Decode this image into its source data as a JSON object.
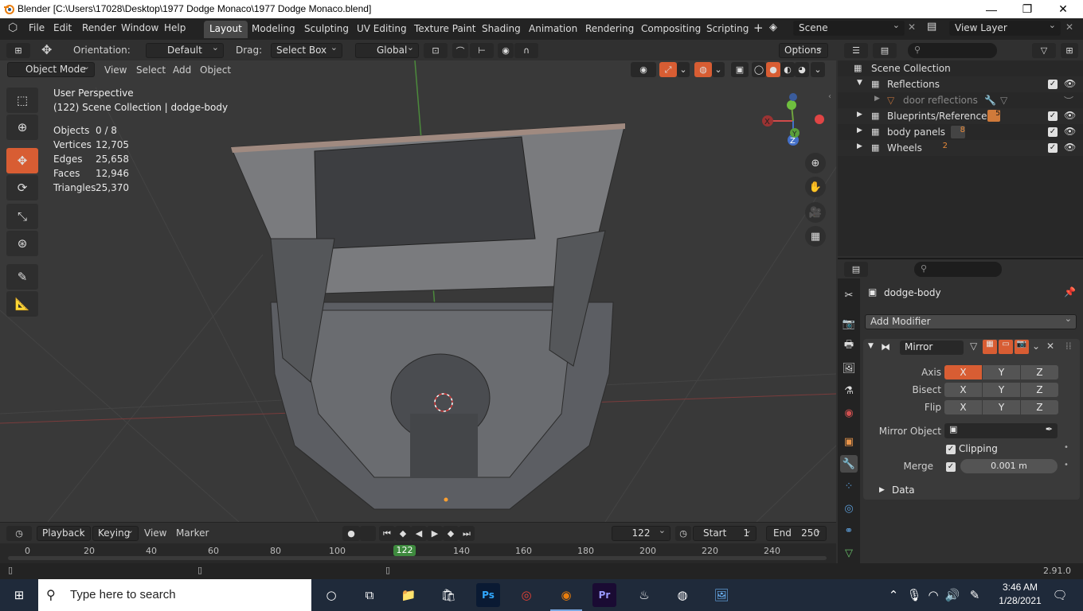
{
  "window": {
    "title": "Blender [C:\\Users\\17028\\Desktop\\1977 Dodge Monaco\\1977 Dodge Monaco.blend]",
    "minimize": "—",
    "maximize": "❐",
    "close": "✕"
  },
  "menu": [
    "File",
    "Edit",
    "Render",
    "Window",
    "Help"
  ],
  "workspaces": [
    "Layout",
    "Modeling",
    "Sculpting",
    "UV Editing",
    "Texture Paint",
    "Shading",
    "Animation",
    "Rendering",
    "Compositing",
    "Scripting"
  ],
  "active_workspace": "Layout",
  "scene": {
    "label": "Scene",
    "view_layer": "View Layer"
  },
  "tool_header": {
    "orientation_label": "Orientation:",
    "orientation_value": "Default",
    "drag_label": "Drag:",
    "drag_value": "Select Box",
    "transform_space": "Global",
    "options": "Options"
  },
  "viewport_header": {
    "mode": "Object Mode",
    "menus": [
      "View",
      "Select",
      "Add",
      "Object"
    ]
  },
  "viewport_overlay": {
    "perspective": "User Perspective",
    "collection_info": "(122) Scene Collection | dodge-body",
    "stats": [
      {
        "label": "Objects",
        "value": "0 / 8"
      },
      {
        "label": "Vertices",
        "value": "12,705"
      },
      {
        "label": "Edges",
        "value": "25,658"
      },
      {
        "label": "Faces",
        "value": "12,946"
      },
      {
        "label": "Triangles",
        "value": "25,370"
      }
    ],
    "gizmo_axes": {
      "x": "X",
      "y": "Y",
      "z": "Z"
    }
  },
  "outliner": {
    "root": "Scene Collection",
    "items": [
      {
        "name": "Reflections",
        "badge": ""
      },
      {
        "name": "door reflections",
        "badge": ""
      },
      {
        "name": "Blueprints/Reference",
        "badge": "5"
      },
      {
        "name": "body panels",
        "badge": "8"
      },
      {
        "name": "Wheels",
        "badge": "2"
      }
    ]
  },
  "properties": {
    "object_name": "dodge-body",
    "add_modifier": "Add Modifier",
    "modifier_name": "Mirror",
    "axis_label": "Axis",
    "bisect_label": "Bisect",
    "flip_label": "Flip",
    "axes": [
      "X",
      "Y",
      "Z"
    ],
    "mirror_object_label": "Mirror Object",
    "clipping_label": "Clipping",
    "merge_label": "Merge",
    "merge_value": "0.001 m",
    "data_label": "Data"
  },
  "timeline": {
    "menus": [
      "Playback",
      "Keying",
      "View",
      "Marker"
    ],
    "current_frame": "122",
    "start_label": "Start",
    "start_value": "1",
    "end_label": "End",
    "end_value": "250",
    "ticks": [
      "0",
      "20",
      "40",
      "60",
      "80",
      "100",
      "140",
      "160",
      "180",
      "200",
      "220",
      "240"
    ],
    "playhead": "122"
  },
  "status": {
    "version": "2.91.0"
  },
  "taskbar": {
    "search_placeholder": "Type here to search",
    "time": "3:46 AM",
    "date": "1/28/2021"
  }
}
